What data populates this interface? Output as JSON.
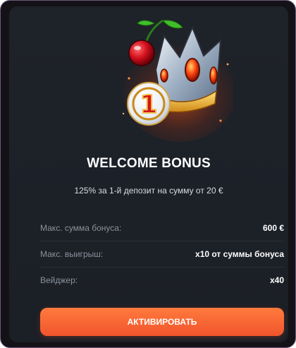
{
  "bonus": {
    "title": "WELCOME BONUS",
    "subtitle": "125% за 1-й депозит на сумму от 20 €",
    "rows": [
      {
        "label": "Макс. сумма бонуса:",
        "value": "600 €"
      },
      {
        "label": "Макс. выигрыш:",
        "value": "x10 от суммы бонуса"
      },
      {
        "label": "Вейджер:",
        "value": "x40"
      }
    ],
    "button_label": "АКТИВИРОВАТЬ",
    "hero_badge_number": "1"
  },
  "colors": {
    "card_bg": "#1e2229",
    "accent": "#f0552c",
    "label": "#8b919c"
  },
  "icons": [
    "crown-cherry-illustration",
    "cherry-icon",
    "crown-icon",
    "coin-one-icon"
  ]
}
